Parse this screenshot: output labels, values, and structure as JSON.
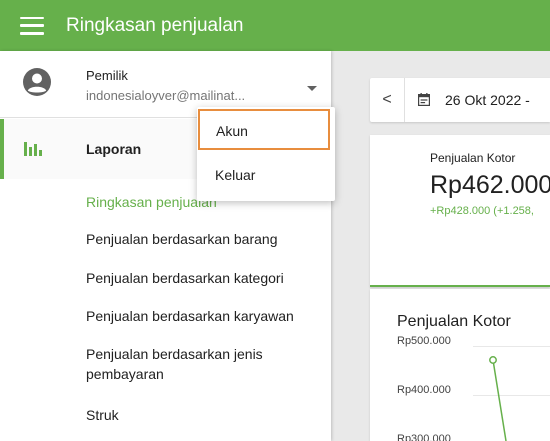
{
  "appbar": {
    "title": "Ringkasan penjualan",
    "menu_icon": "hamburger-menu-icon"
  },
  "account": {
    "role": "Pemilik",
    "email": "indonesialoyver@mailinat..."
  },
  "account_menu": {
    "items": [
      "Akun",
      "Keluar"
    ],
    "focused": "Akun"
  },
  "nav": {
    "report_label": "Laporan",
    "items": [
      {
        "label": "Ringkasan penjualan",
        "active": true
      },
      {
        "label": "Penjualan berdasarkan barang"
      },
      {
        "label": "Penjualan berdasarkan kategori"
      },
      {
        "label": "Penjualan berdasarkan karyawan"
      },
      {
        "label": "Penjualan berdasarkan jenis pembayaran"
      },
      {
        "label": "Struk"
      }
    ]
  },
  "date_range": {
    "text": "26 Okt 2022 -",
    "prev_symbol": "<"
  },
  "metric": {
    "label": "Penjualan Kotor",
    "value": "Rp462.000",
    "change": "+Rp428.000 (+1.258,"
  },
  "chart_data": {
    "type": "line",
    "title": "Penjualan Kotor",
    "y_ticks": [
      "Rp500.000",
      "Rp400.000",
      "Rp300.000"
    ]
  },
  "colors": {
    "accent": "#66b04b",
    "focus_outline": "#e88d3e"
  }
}
